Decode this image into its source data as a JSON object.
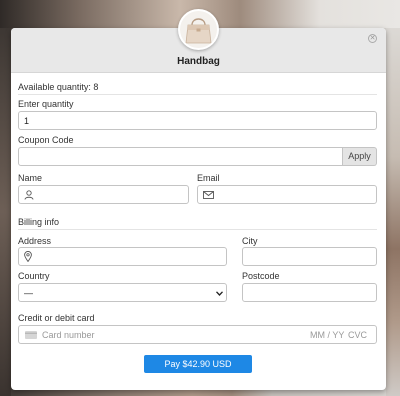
{
  "product": {
    "name": "Handbag",
    "image_icon": "handbag-icon"
  },
  "close_icon": "close-icon",
  "available": "Available quantity: 8",
  "quantity": {
    "label": "Enter quantity",
    "value": "1"
  },
  "coupon": {
    "label": "Coupon Code",
    "value": "",
    "apply_label": "Apply"
  },
  "name": {
    "label": "Name",
    "value": "",
    "icon": "user-icon"
  },
  "email": {
    "label": "Email",
    "value": "",
    "icon": "envelope-icon"
  },
  "billing": {
    "heading": "Billing info",
    "address": {
      "label": "Address",
      "value": "",
      "icon": "map-pin-icon"
    },
    "city": {
      "label": "City",
      "value": ""
    },
    "country": {
      "label": "Country",
      "selected": "—"
    },
    "postcode": {
      "label": "Postcode",
      "value": ""
    }
  },
  "card": {
    "label": "Credit or debit card",
    "number_placeholder": "Card number",
    "expiry_placeholder": "MM / YY",
    "cvc_placeholder": "CVC",
    "icon": "credit-card-icon"
  },
  "pay_button": "Pay $42.90 USD",
  "colors": {
    "pay_button": "#1e88e5",
    "header_bg": "#e8e8e8"
  }
}
